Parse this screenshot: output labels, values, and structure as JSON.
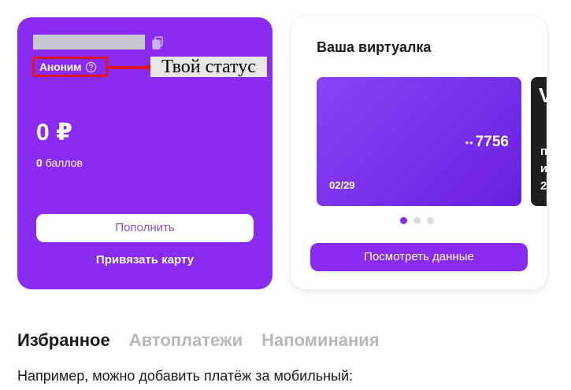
{
  "wallet": {
    "status_label": "Аноним",
    "balance": "0 ₽",
    "points_value": "0",
    "points_label": "баллов",
    "topup_button": "Пополнить",
    "link_card_button": "Привязать карту",
    "background_color": "#8a2bf2"
  },
  "annotation": {
    "label": "Твой статус",
    "color": "#e0141e"
  },
  "virtual_card_panel": {
    "title": "Ваша виртуалка",
    "card": {
      "masked_dots": "••",
      "last_digits": "7756",
      "expiry": "02/29"
    },
    "pager": {
      "total": 3,
      "active_index": 0
    },
    "view_button": "Посмотреть данные"
  },
  "tabs": [
    {
      "label": "Избранное",
      "active": true
    },
    {
      "label": "Автоплатежи",
      "active": false
    },
    {
      "label": "Напоминания",
      "active": false
    }
  ],
  "hint_text": "Например, можно добавить платёж за мобильный:",
  "icons": [
    "copy-icon",
    "help-circle-icon"
  ]
}
